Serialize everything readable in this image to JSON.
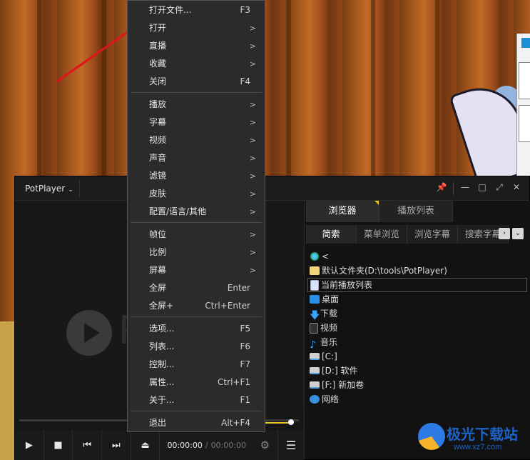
{
  "player": {
    "logo_label": "PotPlayer",
    "big_letter": "P",
    "time_current": "00:00:00",
    "time_separator": "/",
    "time_total": "00:00:00"
  },
  "panel": {
    "tabs": [
      "浏览器",
      "播放列表"
    ],
    "subtabs": [
      "简索",
      "菜单浏览",
      "浏览字幕",
      "搜索字幕"
    ],
    "tree": [
      {
        "icon": "up-level-icon",
        "label": "<"
      },
      {
        "icon": "folder-icon",
        "label": "默认文件夹(D:\\tools\\PotPlayer)"
      },
      {
        "icon": "playlist-icon",
        "label": "当前播放列表",
        "selected": true
      },
      {
        "icon": "desktop-icon",
        "label": "桌面"
      },
      {
        "icon": "download-icon",
        "label": "下载"
      },
      {
        "icon": "video-icon",
        "label": "视频"
      },
      {
        "icon": "music-icon",
        "label": "音乐"
      },
      {
        "icon": "drive-icon",
        "label": "[C:]"
      },
      {
        "icon": "drive-icon",
        "label": "[D:] 软件"
      },
      {
        "icon": "drive-icon",
        "label": "[F:] 新加卷"
      },
      {
        "icon": "network-icon",
        "label": "网络"
      }
    ]
  },
  "menu": {
    "items": [
      {
        "label": "打开文件...",
        "shortcut": "F3"
      },
      {
        "label": "打开",
        "submenu": ">"
      },
      {
        "label": "直播",
        "submenu": ">"
      },
      {
        "label": "收藏",
        "submenu": ">"
      },
      {
        "label": "关闭",
        "shortcut": "F4"
      },
      {
        "label": "播放",
        "submenu": ">"
      },
      {
        "label": "字幕",
        "submenu": ">"
      },
      {
        "label": "视频",
        "submenu": ">"
      },
      {
        "label": "声音",
        "submenu": ">"
      },
      {
        "label": "滤镜",
        "submenu": ">"
      },
      {
        "label": "皮肤",
        "submenu": ">"
      },
      {
        "label": "配置/语言/其他",
        "submenu": ">"
      },
      {
        "label": "帧位",
        "submenu": ">"
      },
      {
        "label": "比例",
        "submenu": ">"
      },
      {
        "label": "屏幕",
        "submenu": ">"
      },
      {
        "label": "全屏",
        "shortcut": "Enter"
      },
      {
        "label": "全屏+",
        "shortcut": "Ctrl+Enter"
      },
      {
        "label": "选项...",
        "shortcut": "F5"
      },
      {
        "label": "列表...",
        "shortcut": "F6"
      },
      {
        "label": "控制...",
        "shortcut": "F7"
      },
      {
        "label": "属性...",
        "shortcut": "Ctrl+F1"
      },
      {
        "label": "关于...",
        "shortcut": "F1"
      },
      {
        "label": "退出",
        "shortcut": "Alt+F4"
      }
    ]
  },
  "watermark": {
    "title": "极光下载站",
    "url": "www.xz7.com"
  },
  "colors": {
    "accent": "#e8c21c",
    "annotation_arrow": "#e0141a"
  }
}
